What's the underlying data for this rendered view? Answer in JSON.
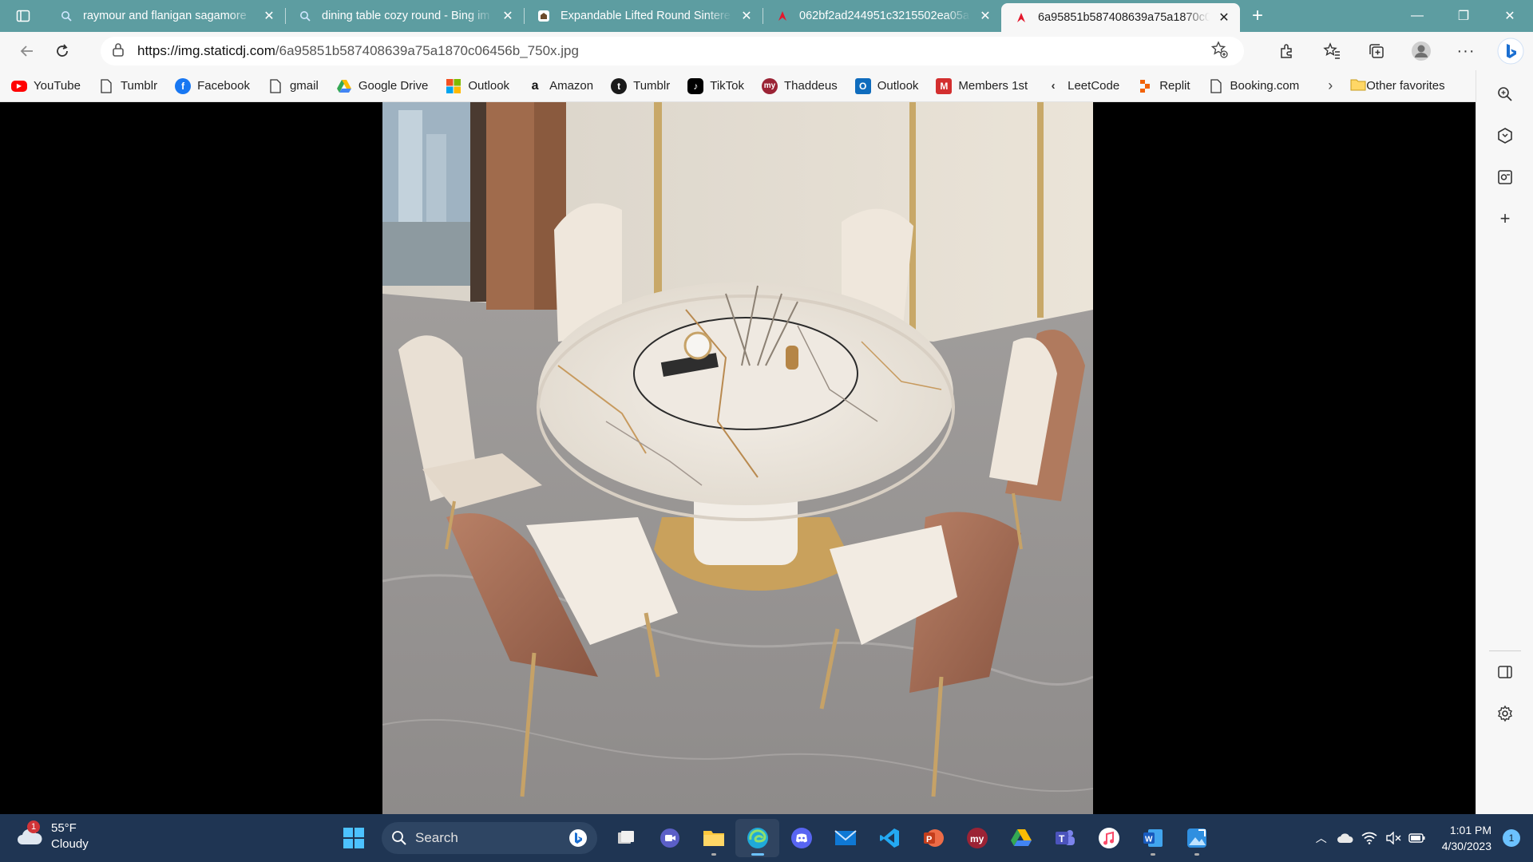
{
  "tabs": [
    {
      "title": "raymour and flanigan sagamore",
      "icon": "search-icon",
      "active": false
    },
    {
      "title": "dining table cozy round - Bing im",
      "icon": "search-icon",
      "active": false
    },
    {
      "title": "Expandable Lifted Round Sintere",
      "icon": "store-icon",
      "active": false
    },
    {
      "title": "062bf2ad244951c3215502ea05a",
      "icon": "image-icon",
      "active": false
    },
    {
      "title": "6a95851b587408639a75a1870c0",
      "icon": "image-icon",
      "active": true
    }
  ],
  "address": {
    "host": "https://img.staticdj.com",
    "path": "/6a95851b587408639a75a1870c06456b_750x.jpg"
  },
  "bookmarks": [
    {
      "label": "YouTube",
      "icon": "youtube-icon",
      "color": "#ff0000"
    },
    {
      "label": "Tumblr",
      "icon": "page-icon",
      "color": ""
    },
    {
      "label": "Facebook",
      "icon": "facebook-icon",
      "color": "#1877f2"
    },
    {
      "label": "gmail",
      "icon": "page-icon",
      "color": ""
    },
    {
      "label": "Google Drive",
      "icon": "drive-icon",
      "color": ""
    },
    {
      "label": "Outlook",
      "icon": "microsoft-icon",
      "color": ""
    },
    {
      "label": "Amazon",
      "icon": "amazon-icon",
      "color": "#111111"
    },
    {
      "label": "Tumblr",
      "icon": "tumblr-icon",
      "color": "#1a1a1a"
    },
    {
      "label": "TikTok",
      "icon": "tiktok-icon",
      "color": "#000000"
    },
    {
      "label": "Thaddeus",
      "icon": "thaddeus-icon",
      "color": "#9b2335"
    },
    {
      "label": "Outlook",
      "icon": "outlook-icon",
      "color": "#0f6cbd"
    },
    {
      "label": "Members 1st",
      "icon": "members1st-icon",
      "color": "#d32f2f"
    },
    {
      "label": "LeetCode",
      "icon": "leetcode-icon",
      "color": ""
    },
    {
      "label": "Replit",
      "icon": "replit-icon",
      "color": "#f26207"
    },
    {
      "label": "Booking.com",
      "icon": "page-icon",
      "color": ""
    }
  ],
  "other_favorites": "Other favorites",
  "weather": {
    "temp": "55°F",
    "condition": "Cloudy",
    "badge": "1"
  },
  "taskbar": {
    "search_label": "Search",
    "apps": [
      "file-explorer-icon",
      "teams-meet-icon",
      "folder-icon",
      "edge-icon",
      "discord-icon",
      "mail-icon",
      "vscode-icon",
      "powerpoint-icon",
      "myapp-icon",
      "google-drive-icon",
      "teams-icon",
      "itunes-icon",
      "word-icon",
      "photos-icon"
    ]
  },
  "clock": {
    "time": "1:01 PM",
    "date": "4/30/2023"
  },
  "notifications": "1",
  "colors": {
    "tabstrip": "#5d9da1",
    "taskbar": "#1f3553",
    "accent": "#6cc2ff"
  }
}
